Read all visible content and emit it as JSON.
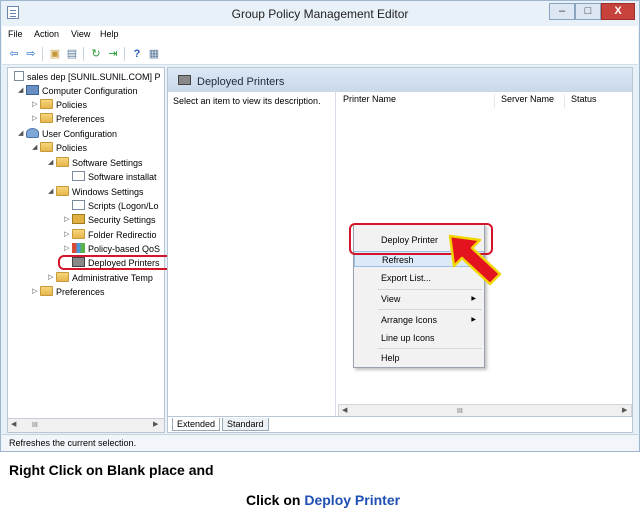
{
  "window": {
    "title": "Group Policy Management Editor",
    "min_label": "–",
    "max_label": "□",
    "close_label": "X"
  },
  "menu": [
    "File",
    "Action",
    "View",
    "Help"
  ],
  "toolbar": {
    "icons": [
      "back-arrow-icon",
      "forward-arrow-icon",
      "up-folder-icon",
      "show-hide-tree-icon",
      "refresh-icon",
      "export-list-icon",
      "help-icon",
      "properties-icon"
    ]
  },
  "tree": {
    "items": [
      {
        "label": "sales dep [SUNIL.SUNIL.COM] P",
        "expander": "",
        "icon": "doc"
      },
      {
        "label": "Computer Configuration",
        "expander": "◢",
        "icon": "pc"
      },
      {
        "label": "Policies",
        "expander": "▷",
        "icon": "folder"
      },
      {
        "label": "Preferences",
        "expander": "▷",
        "icon": "folder"
      },
      {
        "label": "User Configuration",
        "expander": "◢",
        "icon": "user"
      },
      {
        "label": "Policies",
        "expander": "◢",
        "icon": "folder"
      },
      {
        "label": "Software Settings",
        "expander": "◢",
        "icon": "folder"
      },
      {
        "label": "Software installat",
        "expander": "",
        "icon": "doc"
      },
      {
        "label": "Windows Settings",
        "expander": "◢",
        "icon": "folder"
      },
      {
        "label": "Scripts (Logon/Lo",
        "expander": "",
        "icon": "doc"
      },
      {
        "label": "Security Settings",
        "expander": "▷",
        "icon": "shield"
      },
      {
        "label": "Folder Redirectio",
        "expander": "▷",
        "icon": "folder"
      },
      {
        "label": "Policy-based QoS",
        "expander": "▷",
        "icon": "chart"
      },
      {
        "label": "Deployed Printers",
        "expander": "",
        "icon": "printer"
      },
      {
        "label": "Administrative Temp",
        "expander": "▷",
        "icon": "folder"
      },
      {
        "label": "Preferences",
        "expander": "▷",
        "icon": "folder"
      }
    ],
    "scroll_thumb": "III"
  },
  "right_pane": {
    "title": "Deployed Printers",
    "description": "Select an item to view its description.",
    "columns": [
      "Printer Name",
      "Server Name",
      "Status"
    ],
    "scroll_thumb": "III"
  },
  "tabs": [
    "Extended",
    "Standard"
  ],
  "context_menu": {
    "items": [
      {
        "label": "Deploy Printer",
        "submenu": false
      },
      {
        "label": "Refresh",
        "submenu": false
      },
      {
        "label": "Export List...",
        "submenu": false
      },
      {
        "label": "View",
        "submenu": true
      },
      {
        "label": "Arrange Icons",
        "submenu": true
      },
      {
        "label": "Line up Icons",
        "submenu": false
      },
      {
        "label": "Help",
        "submenu": false
      }
    ]
  },
  "status": "Refreshes the current selection.",
  "caption": {
    "line1": "Right Click on Blank place and",
    "line2_prefix": "Click on ",
    "line2_highlight": "Deploy Printer"
  },
  "colors": {
    "highlight_box": "#d4142a",
    "arrow_fill": "#e4141e",
    "arrow_outline": "#f2d600",
    "caption_accent": "#1f4fb5"
  }
}
